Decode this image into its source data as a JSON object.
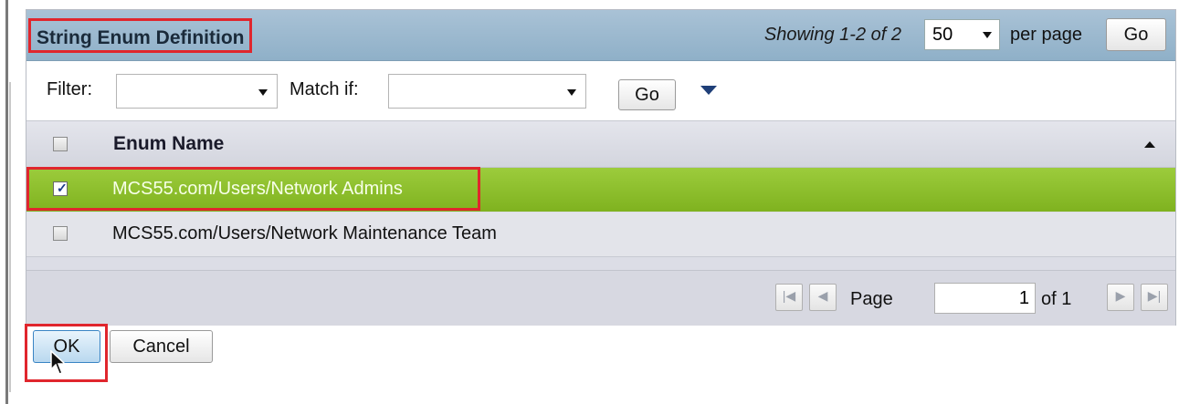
{
  "panel": {
    "title": "String Enum Definition",
    "showing": "Showing 1-2 of 2",
    "per_page_value": "50",
    "per_page_label": "per page",
    "go_label": "Go"
  },
  "filter": {
    "filter_label": "Filter:",
    "filter_value": "",
    "match_label": "Match if:",
    "match_value": "",
    "go_label": "Go",
    "advanced_icon": "triangle-down-icon"
  },
  "table": {
    "column_header": "Enum Name",
    "sort": "ascending",
    "rows": [
      {
        "name": "MCS55.com/Users/Network Admins",
        "checked": true,
        "selected": true
      },
      {
        "name": "MCS55.com/Users/Network Maintenance Team",
        "checked": false,
        "selected": false
      }
    ]
  },
  "pagination": {
    "page_label": "Page",
    "page_value": "1",
    "of_label": "of 1"
  },
  "actions": {
    "ok_label": "OK",
    "cancel_label": "Cancel"
  },
  "colors": {
    "header": "#9fbacf",
    "selected_row": "#8cbf2a",
    "highlight_outline": "#e0262d"
  }
}
